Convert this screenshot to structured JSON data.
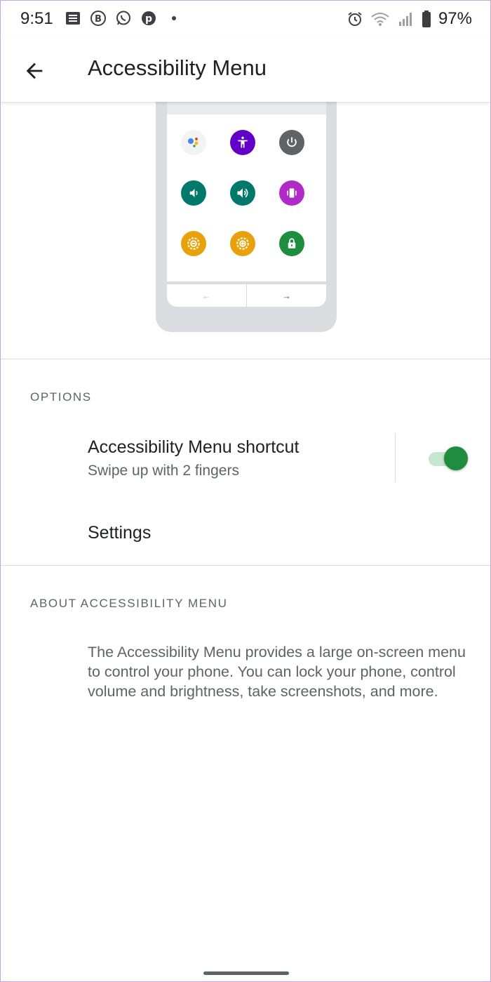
{
  "status_bar": {
    "time": "9:51",
    "battery": "97%",
    "left_icons": [
      "news-icon",
      "business-icon",
      "whatsapp-icon",
      "pinterest-icon",
      "dot-icon"
    ],
    "right_icons": [
      "alarm-icon",
      "wifi-icon",
      "signal-icon",
      "battery-icon"
    ]
  },
  "app_bar": {
    "title": "Accessibility Menu",
    "back_icon": "arrow-back-icon"
  },
  "illustration": {
    "tiles": [
      {
        "name": "assistant-tile",
        "color": "#f1f3f4"
      },
      {
        "name": "accessibility-settings-tile",
        "color": "#6200c8"
      },
      {
        "name": "power-tile",
        "color": "#5f6368"
      },
      {
        "name": "volume-down-tile",
        "color": "#00796b"
      },
      {
        "name": "volume-up-tile",
        "color": "#00796b"
      },
      {
        "name": "vibrate-tile",
        "color": "#b02ac7"
      },
      {
        "name": "brightness-down-tile",
        "color": "#e8a10a"
      },
      {
        "name": "brightness-up-tile",
        "color": "#e8a10a"
      },
      {
        "name": "lock-screen-tile",
        "color": "#1e8e3e"
      }
    ],
    "nav_back": "←",
    "nav_forward": "→"
  },
  "options": {
    "header": "OPTIONS",
    "shortcut": {
      "title": "Accessibility Menu shortcut",
      "summary": "Swipe up with 2 fingers",
      "enabled": true
    },
    "settings": {
      "title": "Settings"
    }
  },
  "about": {
    "header": "ABOUT ACCESSIBILITY MENU",
    "body": "The Accessibility Menu provides a large on-screen menu to control your phone. You can lock your phone, control volume and brightness, take screenshots, and more."
  },
  "colors": {
    "accent": "#1e8e3e",
    "text_primary": "#202124",
    "text_secondary": "#5f6368",
    "divider": "#dadce0"
  }
}
